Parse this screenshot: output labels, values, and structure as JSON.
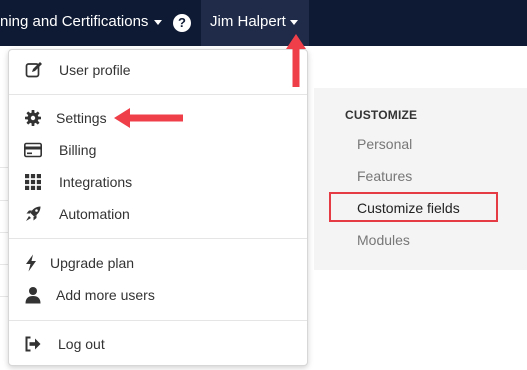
{
  "navbar": {
    "training_menu_label": "ning and Certifications",
    "help_label": "?",
    "user_name": "Jim Halpert"
  },
  "dropdown": {
    "user_profile": "User profile",
    "settings": "Settings",
    "billing": "Billing",
    "integrations": "Integrations",
    "automation": "Automation",
    "upgrade_plan": "Upgrade plan",
    "add_more_users": "Add more users",
    "log_out": "Log out"
  },
  "customize": {
    "heading": "CUSTOMIZE",
    "links": [
      "Personal",
      "Features",
      "Customize fields",
      "Modules"
    ],
    "active_index": 2
  },
  "colors": {
    "navbar_bg": "#0e1a33",
    "highlight": "#e53b44"
  }
}
